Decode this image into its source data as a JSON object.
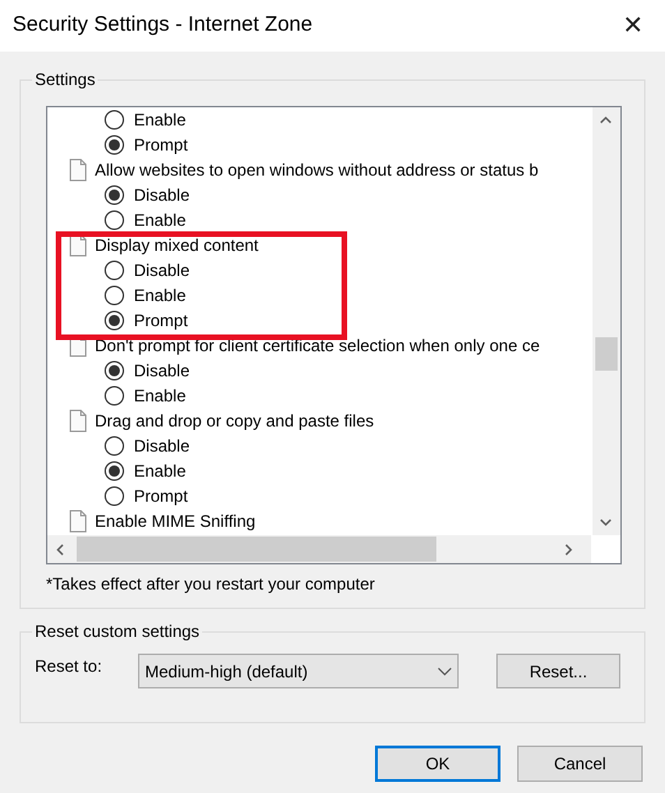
{
  "window": {
    "title": "Security Settings - Internet Zone",
    "close": "✕"
  },
  "settings": {
    "legend": "Settings",
    "groups": [
      {
        "options": [
          {
            "label": "Enable",
            "selected": false
          },
          {
            "label": "Prompt",
            "selected": true
          }
        ]
      },
      {
        "label": "Allow websites to open windows without address or status b",
        "options": [
          {
            "label": "Disable",
            "selected": true
          },
          {
            "label": "Enable",
            "selected": false
          }
        ]
      },
      {
        "label": "Display mixed content",
        "highlighted": true,
        "options": [
          {
            "label": "Disable",
            "selected": false
          },
          {
            "label": "Enable",
            "selected": false
          },
          {
            "label": "Prompt",
            "selected": true
          }
        ]
      },
      {
        "label": "Don't prompt for client certificate selection when only one ce",
        "options": [
          {
            "label": "Disable",
            "selected": true
          },
          {
            "label": "Enable",
            "selected": false
          }
        ]
      },
      {
        "label": "Drag and drop or copy and paste files",
        "options": [
          {
            "label": "Disable",
            "selected": false
          },
          {
            "label": "Enable",
            "selected": true
          },
          {
            "label": "Prompt",
            "selected": false
          }
        ]
      },
      {
        "label": "Enable MIME Sniffing"
      }
    ],
    "note": "*Takes effect after you restart your computer"
  },
  "reset": {
    "legend": "Reset custom settings",
    "label": "Reset to:",
    "value": "Medium-high (default)",
    "button": "Reset..."
  },
  "buttons": [
    {
      "label": "OK",
      "default": true
    },
    {
      "label": "Cancel",
      "default": false
    }
  ]
}
